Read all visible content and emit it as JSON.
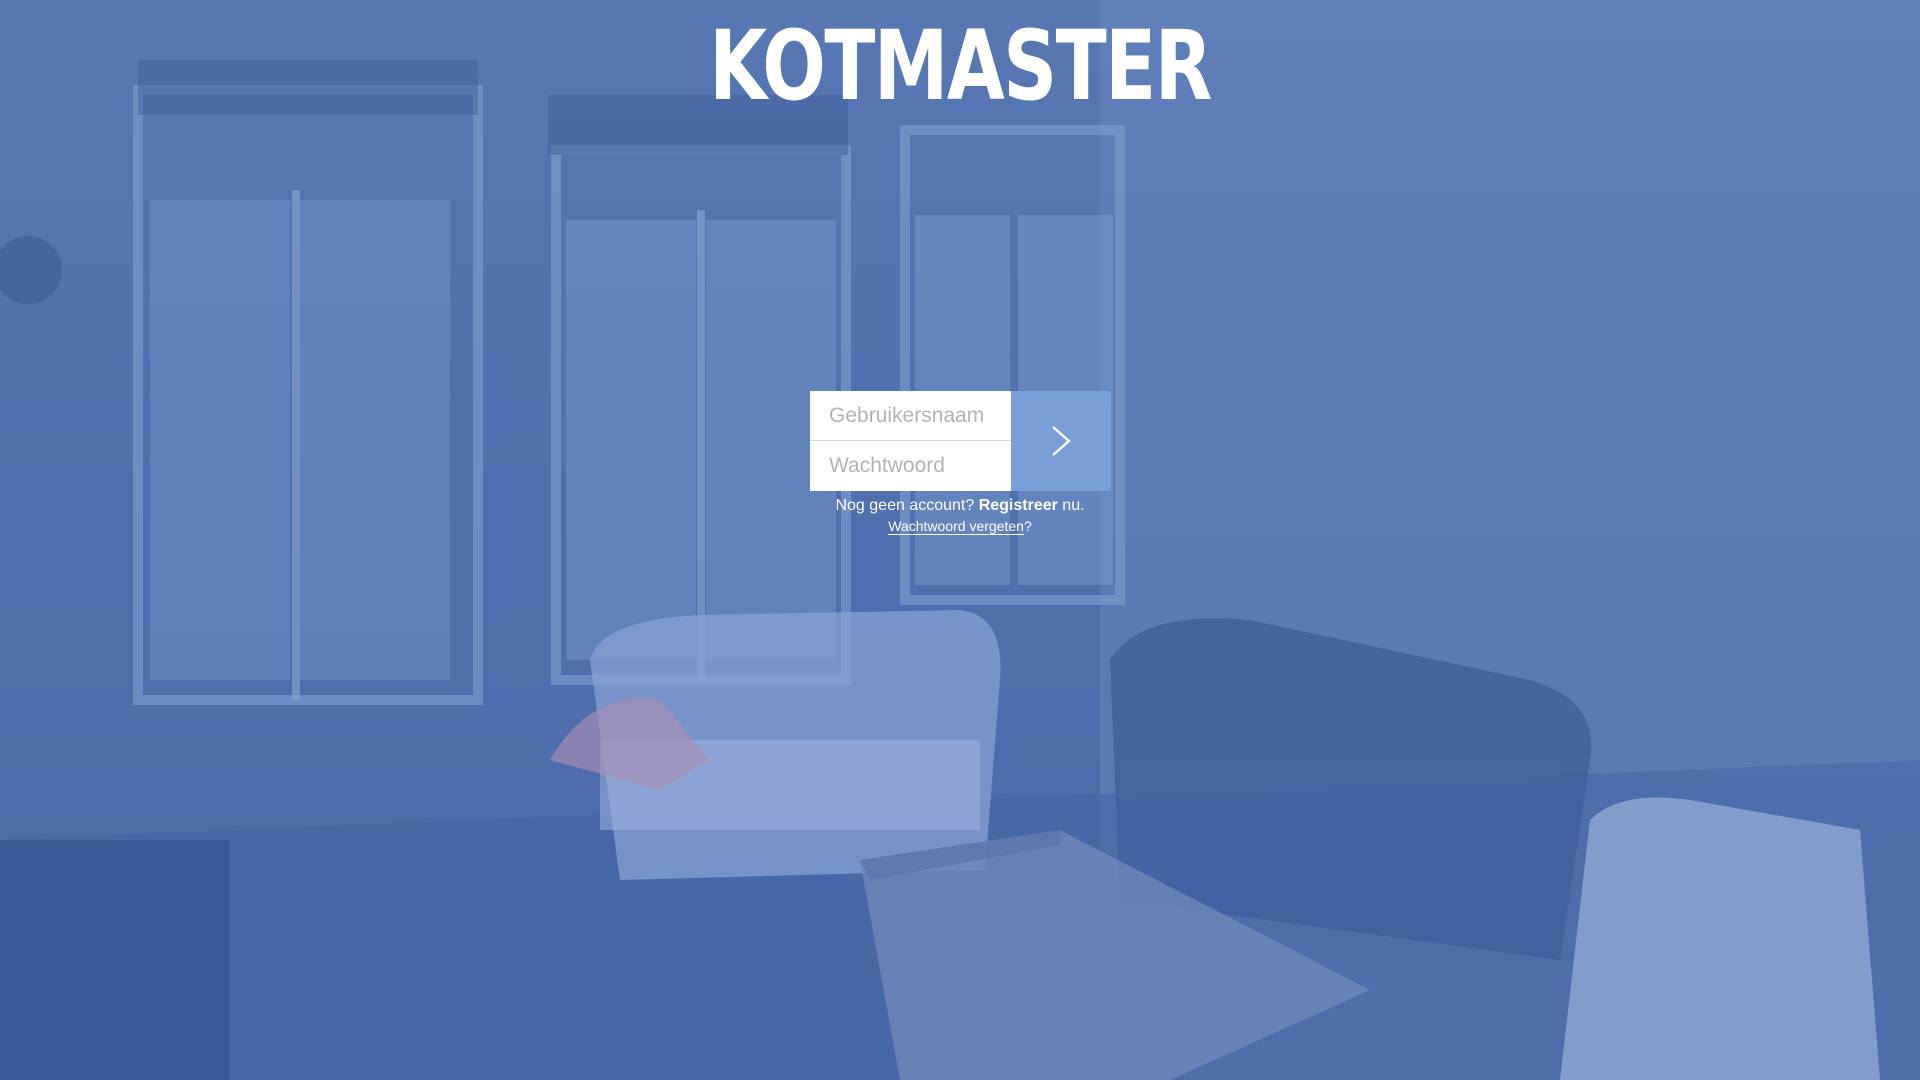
{
  "app": {
    "logo_text": "KOTMASTER"
  },
  "login_form": {
    "username_placeholder": "Gebruikersnaam",
    "password_placeholder": "Wachtwoord",
    "submit_icon": "chevron-right-icon"
  },
  "links": {
    "register_prefix": "Nog geen account? ",
    "register_link": "Registreer",
    "register_suffix": " nu.",
    "forgot_link": "Wachtwoord vergeten",
    "forgot_suffix": "?"
  },
  "colors": {
    "overlay": "#5074b0",
    "submit_button": "#7a9fd8",
    "text": "#ffffff"
  }
}
